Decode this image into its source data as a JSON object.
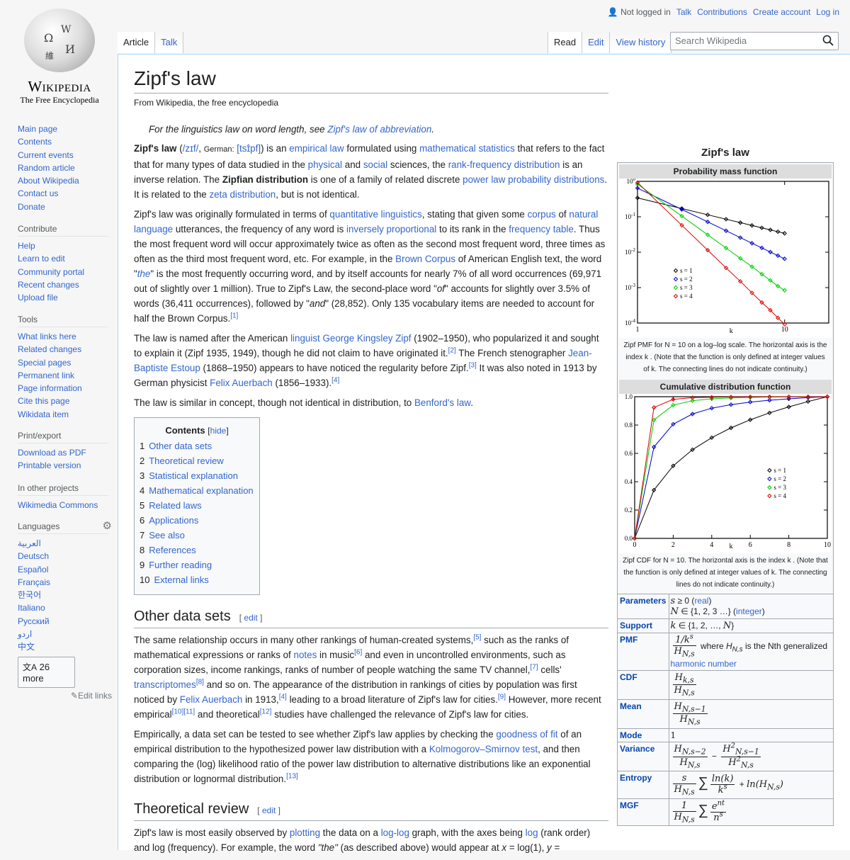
{
  "logo": {
    "wordmark": "Wikipedia",
    "tagline": "The Free Encyclopedia"
  },
  "personal": {
    "status": "Not logged in",
    "links": [
      "Talk",
      "Contributions",
      "Create account",
      "Log in"
    ]
  },
  "tabs_left": [
    {
      "label": "Article",
      "selected": true
    },
    {
      "label": "Talk",
      "selected": false
    }
  ],
  "tabs_right": [
    {
      "label": "Read",
      "selected": true
    },
    {
      "label": "Edit",
      "selected": false
    },
    {
      "label": "View history",
      "selected": false
    }
  ],
  "search": {
    "placeholder": "Search Wikipedia"
  },
  "sidebar": {
    "navigation": [
      "Main page",
      "Contents",
      "Current events",
      "Random article",
      "About Wikipedia",
      "Contact us",
      "Donate"
    ],
    "contribute": {
      "heading": "Contribute",
      "items": [
        "Help",
        "Learn to edit",
        "Community portal",
        "Recent changes",
        "Upload file"
      ]
    },
    "tools": {
      "heading": "Tools",
      "items": [
        "What links here",
        "Related changes",
        "Special pages",
        "Permanent link",
        "Page information",
        "Cite this page",
        "Wikidata item"
      ]
    },
    "print": {
      "heading": "Print/export",
      "items": [
        "Download as PDF",
        "Printable version"
      ]
    },
    "projects": {
      "heading": "In other projects",
      "items": [
        "Wikimedia Commons"
      ]
    },
    "languages": {
      "heading": "Languages",
      "items": [
        "العربية",
        "Deutsch",
        "Español",
        "Français",
        "한국어",
        "Italiano",
        "Русский",
        "اردو",
        "中文"
      ],
      "more": "26 more",
      "edit_links": "Edit links"
    }
  },
  "article": {
    "title": "Zipf's law",
    "subtitle": "From Wikipedia, the free encyclopedia",
    "hatnote": {
      "text": "For the linguistics law on word length, see ",
      "link": "Zipf's law of abbreviation",
      "end": "."
    },
    "toc": {
      "title": "Contents",
      "hide": "hide",
      "items": [
        {
          "num": "1",
          "label": "Other data sets"
        },
        {
          "num": "2",
          "label": "Theoretical review"
        },
        {
          "num": "3",
          "label": "Statistical explanation"
        },
        {
          "num": "4",
          "label": "Mathematical explanation"
        },
        {
          "num": "5",
          "label": "Related laws"
        },
        {
          "num": "6",
          "label": "Applications"
        },
        {
          "num": "7",
          "label": "See also"
        },
        {
          "num": "8",
          "label": "References"
        },
        {
          "num": "9",
          "label": "Further reading"
        },
        {
          "num": "10",
          "label": "External links"
        }
      ]
    },
    "sections": [
      {
        "heading": "Other data sets",
        "edit": "edit"
      },
      {
        "heading": "Theoretical review",
        "edit": "edit"
      }
    ]
  },
  "infobox": {
    "title": "Zipf's law",
    "pmf_heading": "Probability mass function",
    "pmf_caption": "Zipf PMF for N = 10 on a log–log scale. The horizontal axis is the index k . (Note that the function is only defined at integer values of k. The connecting lines do not indicate continuity.)",
    "cdf_heading": "Cumulative distribution function",
    "cdf_caption": "Zipf CDF for N = 10. The horizontal axis is the index k . (Note that the function is only defined at integer values of k. The connecting lines do not indicate continuity.)",
    "rows": [
      {
        "label": "Parameters"
      },
      {
        "label": "Support"
      },
      {
        "label": "PMF"
      },
      {
        "label": "CDF"
      },
      {
        "label": "Mean"
      },
      {
        "label": "Mode"
      },
      {
        "label": "Variance"
      },
      {
        "label": "Entropy"
      },
      {
        "label": "MGF"
      }
    ],
    "param_real": "real",
    "param_integer": "integer",
    "pmf_where": "is the Nth generalized",
    "pmf_link": "harmonic number",
    "mode_value": "1"
  },
  "chart_data": [
    {
      "type": "line",
      "title": "Probability mass function",
      "xlabel": "k",
      "ylabel": "",
      "xscale": "log",
      "yscale": "log",
      "xlim": [
        1,
        10
      ],
      "ylim": [
        0.0001,
        1
      ],
      "x_ticks": [
        "1",
        "10"
      ],
      "y_ticks": [
        "10^0",
        "10^-1",
        "10^-2",
        "10^-3",
        "10^-4"
      ],
      "x": [
        1,
        2,
        3,
        4,
        5,
        6,
        7,
        8,
        9,
        10
      ],
      "legend_position": "center-left",
      "series": [
        {
          "name": "s = 1",
          "color": "#000000",
          "values": [
            0.3414,
            0.1707,
            0.1138,
            0.0854,
            0.0683,
            0.0569,
            0.0488,
            0.0427,
            0.0379,
            0.0341
          ]
        },
        {
          "name": "s = 2",
          "color": "#0000cc",
          "values": [
            0.6452,
            0.1613,
            0.0717,
            0.0403,
            0.0258,
            0.0179,
            0.0132,
            0.0101,
            0.008,
            0.0065
          ]
        },
        {
          "name": "s = 3",
          "color": "#00cc00",
          "values": [
            0.8363,
            0.1045,
            0.031,
            0.0131,
            0.0067,
            0.0039,
            0.0024,
            0.0016,
            0.0011,
            0.00084
          ]
        },
        {
          "name": "s = 4",
          "color": "#dd0000",
          "values": [
            0.9238,
            0.0577,
            0.0114,
            0.0036,
            0.0015,
            0.00071,
            0.00038,
            0.00023,
            0.00014,
            9.2e-05
          ]
        }
      ]
    },
    {
      "type": "line",
      "title": "Cumulative distribution function",
      "xlabel": "k",
      "ylabel": "",
      "xlim": [
        0,
        10
      ],
      "ylim": [
        0,
        1
      ],
      "x_ticks": [
        "0",
        "2",
        "4",
        "6",
        "8",
        "10"
      ],
      "y_ticks": [
        "0.0",
        "0.2",
        "0.4",
        "0.6",
        "0.8",
        "1.0"
      ],
      "x": [
        0,
        1,
        2,
        3,
        4,
        5,
        6,
        7,
        8,
        9,
        10
      ],
      "legend_position": "center-right",
      "series": [
        {
          "name": "s = 1",
          "color": "#000000",
          "values": [
            0,
            0.341,
            0.512,
            0.626,
            0.711,
            0.78,
            0.837,
            0.886,
            0.928,
            0.966,
            1.0
          ]
        },
        {
          "name": "s = 2",
          "color": "#0000cc",
          "values": [
            0,
            0.645,
            0.806,
            0.878,
            0.919,
            0.944,
            0.962,
            0.975,
            0.985,
            0.994,
            1.0
          ]
        },
        {
          "name": "s = 3",
          "color": "#00cc00",
          "values": [
            0,
            0.836,
            0.941,
            0.972,
            0.985,
            0.991,
            0.995,
            0.998,
            0.999,
            0.999,
            1.0
          ]
        },
        {
          "name": "s = 4",
          "color": "#dd0000",
          "values": [
            0,
            0.924,
            0.981,
            0.993,
            0.996,
            0.998,
            0.999,
            0.9995,
            0.9998,
            0.9999,
            1.0
          ]
        }
      ]
    }
  ]
}
